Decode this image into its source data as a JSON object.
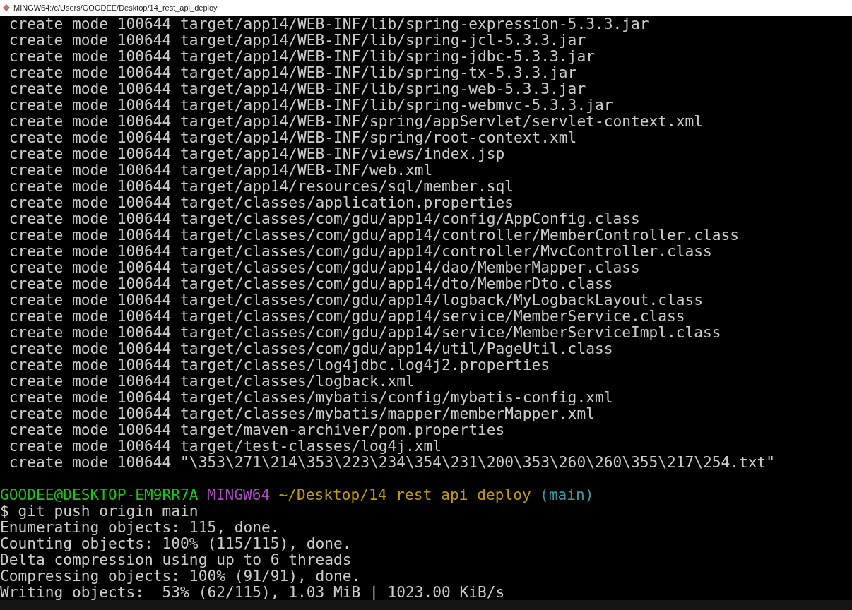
{
  "window": {
    "title": "MINGW64:/c/Users/GOODEE/Desktop/14_rest_api_deploy"
  },
  "create_lines": [
    " create mode 100644 target/app14/WEB-INF/lib/spring-expression-5.3.3.jar",
    " create mode 100644 target/app14/WEB-INF/lib/spring-jcl-5.3.3.jar",
    " create mode 100644 target/app14/WEB-INF/lib/spring-jdbc-5.3.3.jar",
    " create mode 100644 target/app14/WEB-INF/lib/spring-tx-5.3.3.jar",
    " create mode 100644 target/app14/WEB-INF/lib/spring-web-5.3.3.jar",
    " create mode 100644 target/app14/WEB-INF/lib/spring-webmvc-5.3.3.jar",
    " create mode 100644 target/app14/WEB-INF/spring/appServlet/servlet-context.xml",
    " create mode 100644 target/app14/WEB-INF/spring/root-context.xml",
    " create mode 100644 target/app14/WEB-INF/views/index.jsp",
    " create mode 100644 target/app14/WEB-INF/web.xml",
    " create mode 100644 target/app14/resources/sql/member.sql",
    " create mode 100644 target/classes/application.properties",
    " create mode 100644 target/classes/com/gdu/app14/config/AppConfig.class",
    " create mode 100644 target/classes/com/gdu/app14/controller/MemberController.class",
    " create mode 100644 target/classes/com/gdu/app14/controller/MvcController.class",
    " create mode 100644 target/classes/com/gdu/app14/dao/MemberMapper.class",
    " create mode 100644 target/classes/com/gdu/app14/dto/MemberDto.class",
    " create mode 100644 target/classes/com/gdu/app14/logback/MyLogbackLayout.class",
    " create mode 100644 target/classes/com/gdu/app14/service/MemberService.class",
    " create mode 100644 target/classes/com/gdu/app14/service/MemberServiceImpl.class",
    " create mode 100644 target/classes/com/gdu/app14/util/PageUtil.class",
    " create mode 100644 target/classes/log4jdbc.log4j2.properties",
    " create mode 100644 target/classes/logback.xml",
    " create mode 100644 target/classes/mybatis/config/mybatis-config.xml",
    " create mode 100644 target/classes/mybatis/mapper/memberMapper.xml",
    " create mode 100644 target/maven-archiver/pom.properties",
    " create mode 100644 target/test-classes/log4j.xml",
    " create mode 100644 \"\\353\\271\\214\\353\\223\\234\\354\\231\\200\\353\\260\\260\\355\\217\\254.txt\""
  ],
  "prompt": [
    {
      "text": "GOODEE@DESKTOP-EM9RR7A",
      "color": "#16c60c"
    },
    {
      "text": "MINGW64",
      "color": "#b148c6"
    },
    {
      "text": "~/Desktop/14_rest_api_deploy",
      "color": "#c19c00"
    },
    {
      "text": "(main)",
      "color": "#3a96a0"
    }
  ],
  "command": "$ git push origin main",
  "output": [
    "Enumerating objects: 115, done.",
    "Counting objects: 100% (115/115), done.",
    "Delta compression using up to 6 threads",
    "Compressing objects: 100% (91/91), done.",
    "Writing objects:  53% (62/115), 1.03 MiB | 1023.00 KiB/s"
  ]
}
